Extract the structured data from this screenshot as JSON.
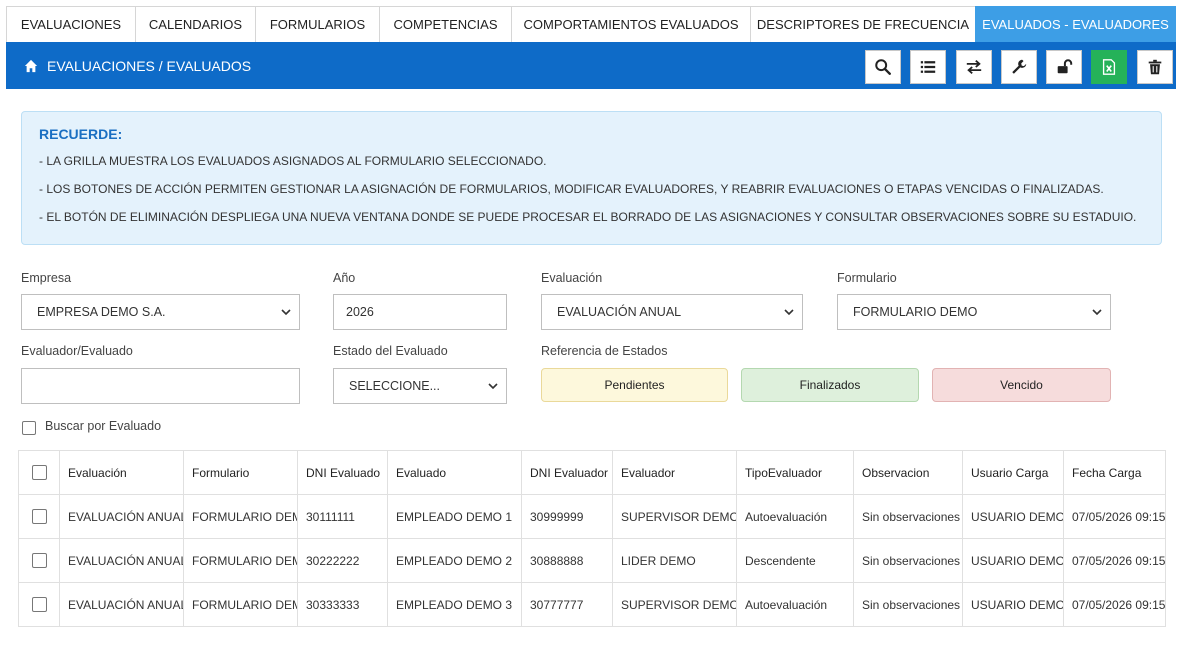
{
  "tabs": [
    {
      "label": "EVALUACIONES"
    },
    {
      "label": "CALENDARIOS"
    },
    {
      "label": "FORMULARIOS"
    },
    {
      "label": "COMPETENCIAS"
    },
    {
      "label": "COMPORTAMIENTOS EVALUADOS"
    },
    {
      "label": "DESCRIPTORES DE FRECUENCIA"
    },
    {
      "label": "EVALUADOS - EVALUADORES"
    }
  ],
  "header": {
    "title": "EVALUACIONES / EVALUADOS",
    "tools": [
      "search-icon",
      "list-icon",
      "swap-icon",
      "wrench-icon",
      "unlock-icon",
      "excel-icon",
      "trash-icon"
    ],
    "accent": "#0e6bc8"
  },
  "info": {
    "title": "RECUERDE:",
    "lines": [
      "- LA GRILLA MUESTRA LOS EVALUADOS ASIGNADOS AL FORMULARIO SELECCIONADO.",
      "- LOS BOTONES DE ACCIÓN PERMITEN GESTIONAR LA ASIGNACIÓN DE FORMULARIOS, MODIFICAR EVALUADORES, Y REABRIR EVALUACIONES O ETAPAS VENCIDAS O FINALIZADAS.",
      "- EL BOTÓN DE ELIMINACIÓN DESPLIEGA UNA NUEVA VENTANA DONDE SE PUEDE PROCESAR EL BORRADO DE LAS ASIGNACIONES Y CONSULTAR OBSERVACIONES SOBRE SU ESTADUIO."
    ]
  },
  "form": {
    "empresa": {
      "label": "Empresa",
      "value": "EMPRESA DEMO S.A."
    },
    "anio": {
      "label": "Año",
      "value": "2026"
    },
    "evaluacion": {
      "label": "Evaluación",
      "value": "EVALUACIÓN ANUAL"
    },
    "formulario": {
      "label": "Formulario",
      "value": "FORMULARIO DEMO"
    },
    "evaluador": {
      "label": "Evaluador/Evaluado",
      "value": ""
    },
    "estado": {
      "label": "Estado del Evaluado",
      "value": "SELECCIONE..."
    },
    "referencia": {
      "label": "Referencia de Estados",
      "items": [
        {
          "label": "Pendientes",
          "color": "#fdf8dc"
        },
        {
          "label": "Finalizados",
          "color": "#def0dc"
        },
        {
          "label": "Vencido",
          "color": "#f6dcdc"
        }
      ]
    },
    "buscar_por_evaluado": "Buscar por Evaluado"
  },
  "table": {
    "columns": [
      "Evaluación",
      "Formulario",
      "DNI Evaluado",
      "Evaluado",
      "DNI Evaluador",
      "Evaluador",
      "TipoEvaluador",
      "Observacion",
      "Usuario Carga",
      "Fecha Carga"
    ],
    "rows": [
      [
        "EVALUACIÓN ANUAL",
        "FORMULARIO DEMO",
        "30111111",
        "EMPLEADO DEMO 1",
        "30999999",
        "SUPERVISOR DEMO",
        "Autoevaluación",
        "Sin observaciones",
        "USUARIO DEMO",
        "07/05/2026 09:15"
      ],
      [
        "EVALUACIÓN ANUAL",
        "FORMULARIO DEMO",
        "30222222",
        "EMPLEADO DEMO 2",
        "30888888",
        "LIDER DEMO",
        "Descendente",
        "Sin observaciones",
        "USUARIO DEMO",
        "07/05/2026 09:15"
      ],
      [
        "EVALUACIÓN ANUAL",
        "FORMULARIO DEMO",
        "30333333",
        "EMPLEADO DEMO 3",
        "30777777",
        "SUPERVISOR DEMO",
        "Autoevaluación",
        "Sin observaciones",
        "USUARIO DEMO",
        "07/05/2026 09:15"
      ]
    ]
  }
}
